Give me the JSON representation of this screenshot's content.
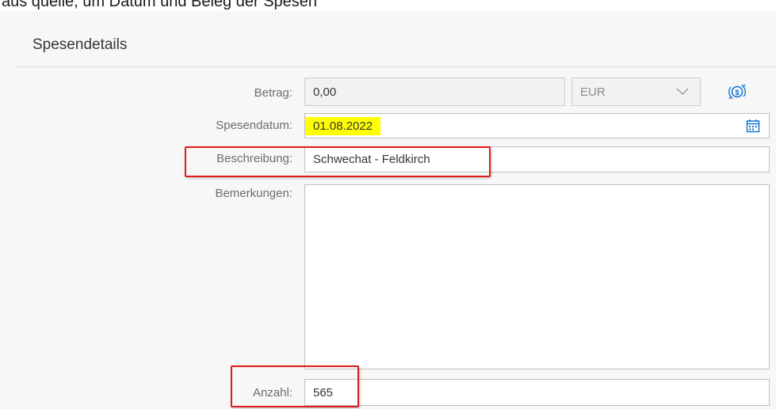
{
  "header": {
    "clipped_text": "aus quelle, um Datum und Beleg der Spesen"
  },
  "section": {
    "title": "Spesendetails"
  },
  "form": {
    "betrag": {
      "label": "Betrag:",
      "value": "0,00",
      "currency": "EUR"
    },
    "spesendatum": {
      "label": "Spesendatum:",
      "value": "01.08.2022"
    },
    "beschreibung": {
      "label": "Beschreibung:",
      "value": "Schwechat - Feldkirch"
    },
    "bemerkungen": {
      "label": "Bemerkungen:",
      "value": ""
    },
    "anzahl": {
      "label": "Anzahl:",
      "value": "565"
    }
  },
  "colors": {
    "highlight": "#ffff00",
    "annotation_red": "#e01b1b",
    "icon_blue": "#0a6ed1"
  },
  "icons": {
    "currency_convert": "currency-exchange-icon",
    "calendar": "calendar-icon",
    "dropdown": "chevron-down-icon"
  }
}
